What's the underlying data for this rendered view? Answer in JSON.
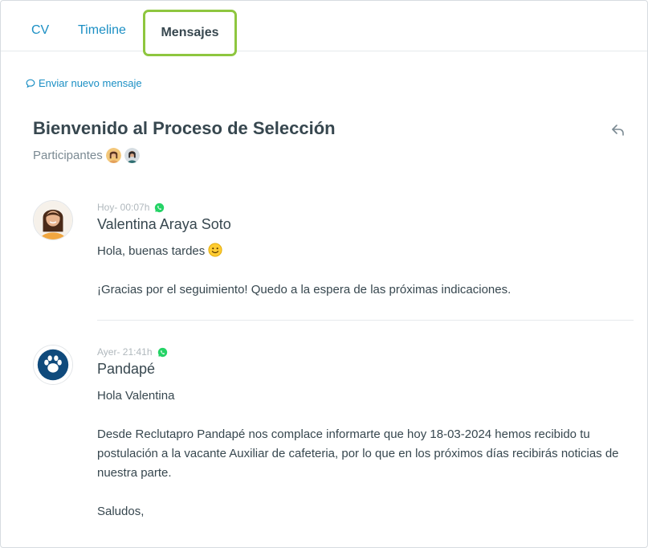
{
  "tabs": [
    {
      "label": "CV"
    },
    {
      "label": "Timeline"
    },
    {
      "label": "Mensajes",
      "active": true
    }
  ],
  "actions": {
    "new_message": "Enviar nuevo mensaje"
  },
  "thread": {
    "title": "Bienvenido al Proceso de Selección",
    "participants_label": "Participantes"
  },
  "messages": [
    {
      "time": "Hoy- 00:07h",
      "channel_icon": "whatsapp-icon",
      "sender": "Valentina Araya Soto",
      "lines": [
        "Hola, buenas tardes",
        "¡Gracias por el seguimiento! Quedo a la espera de las próximas indicaciones."
      ]
    },
    {
      "time": "Ayer- 21:41h",
      "channel_icon": "whatsapp-icon",
      "sender": "Pandapé",
      "lines": [
        "Hola Valentina",
        "Desde Reclutapro Pandapé nos complace informarte que hoy 18-03-2024 hemos recibido tu postulación a la vacante Auxiliar de cafeteria, por lo que en los próximos días recibirás noticias de nuestra parte.",
        "Saludos,"
      ]
    }
  ],
  "colors": {
    "accent": "#1b8fc4",
    "active_tab_border": "#8ec63f",
    "whatsapp": "#25d366",
    "brand_avatar": "#0f4a7c"
  }
}
